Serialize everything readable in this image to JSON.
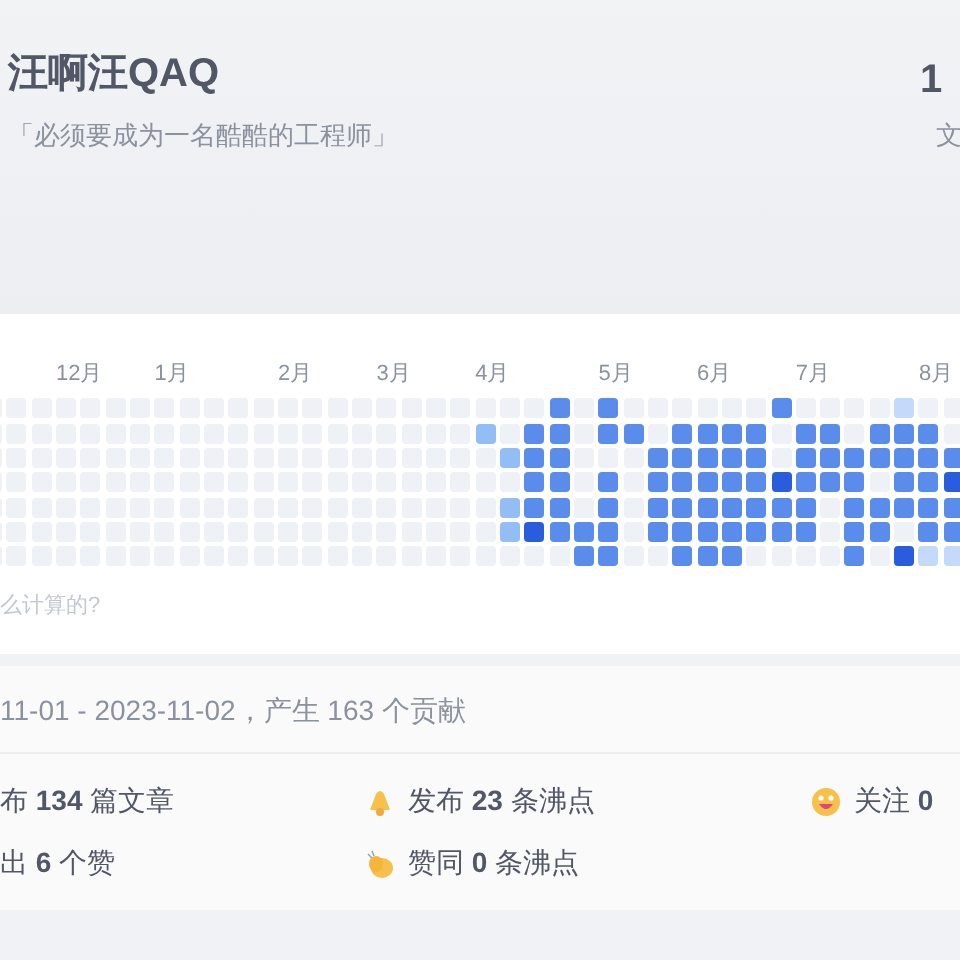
{
  "profile": {
    "name": "汪啊汪QAQ",
    "motto": "「必须要成为一名酷酷的工程师」",
    "stat_value": "1",
    "stat_label": "文"
  },
  "heatmap": {
    "weeks": [
      {
        "days": [
          {
            "color": "#eef1f6"
          },
          {
            "color": "#eef1f6"
          },
          {
            "color": "#eef1f6"
          },
          {
            "color": "#eef1f6"
          },
          {
            "color": "#eef1f6"
          },
          {
            "color": "#eef1f6"
          },
          {
            "color": "#eef1f6"
          }
        ]
      },
      {
        "days": [
          {
            "color": "#eef1f6"
          },
          {
            "color": "#eef1f6"
          },
          {
            "color": "#eef1f6"
          },
          {
            "color": "#eef1f6"
          },
          {
            "color": "#eef1f6"
          },
          {
            "color": "#eef1f6"
          },
          {
            "color": "#eef1f6"
          }
        ]
      },
      {
        "days": [
          {
            "color": "#eef1f6"
          },
          {
            "color": "#eef1f6"
          },
          {
            "color": "#eef1f6"
          },
          {
            "color": "#eef1f6"
          },
          {
            "color": "#eef1f6"
          },
          {
            "color": "#eef1f6"
          },
          {
            "color": "#eef1f6"
          }
        ]
      },
      {
        "month": "12月",
        "days": [
          {
            "color": "#eef1f6"
          },
          {
            "color": "#eef1f6"
          },
          {
            "color": "#eef1f6"
          },
          {
            "color": "#eef1f6"
          },
          {
            "color": "#eef1f6"
          },
          {
            "color": "#eef1f6"
          },
          {
            "color": "#eef1f6"
          }
        ]
      },
      {
        "days": [
          {
            "color": "#eef1f6"
          },
          {
            "color": "#eef1f6"
          },
          {
            "color": "#eef1f6"
          },
          {
            "color": "#eef1f6"
          },
          {
            "color": "#eef1f6"
          },
          {
            "color": "#eef1f6"
          },
          {
            "color": "#eef1f6"
          }
        ]
      },
      {
        "days": [
          {
            "color": "#eef1f6"
          },
          {
            "color": "#eef1f6"
          },
          {
            "color": "#eef1f6"
          },
          {
            "color": "#eef1f6"
          },
          {
            "color": "#eef1f6"
          },
          {
            "color": "#eef1f6"
          },
          {
            "color": "#eef1f6"
          }
        ]
      },
      {
        "days": [
          {
            "color": "#eef1f6"
          },
          {
            "color": "#eef1f6"
          },
          {
            "color": "#eef1f6"
          },
          {
            "color": "#eef1f6"
          },
          {
            "color": "#eef1f6"
          },
          {
            "color": "#eef1f6"
          },
          {
            "color": "#eef1f6"
          }
        ]
      },
      {
        "month": "1月",
        "days": [
          {
            "color": "#eef1f6"
          },
          {
            "color": "#eef1f6"
          },
          {
            "color": "#eef1f6"
          },
          {
            "color": "#eef1f6"
          },
          {
            "color": "#eef1f6"
          },
          {
            "color": "#eef1f6"
          },
          {
            "color": "#eef1f6"
          }
        ]
      },
      {
        "days": [
          {
            "color": "#eef1f6"
          },
          {
            "color": "#eef1f6"
          },
          {
            "color": "#eef1f6"
          },
          {
            "color": "#eef1f6"
          },
          {
            "color": "#eef1f6"
          },
          {
            "color": "#eef1f6"
          },
          {
            "color": "#eef1f6"
          }
        ]
      },
      {
        "days": [
          {
            "color": "#eef1f6"
          },
          {
            "color": "#eef1f6"
          },
          {
            "color": "#eef1f6"
          },
          {
            "color": "#eef1f6"
          },
          {
            "color": "#eef1f6"
          },
          {
            "color": "#eef1f6"
          },
          {
            "color": "#eef1f6"
          }
        ]
      },
      {
        "days": [
          {
            "color": "#eef1f6"
          },
          {
            "color": "#eef1f6"
          },
          {
            "color": "#eef1f6"
          },
          {
            "color": "#eef1f6"
          },
          {
            "color": "#eef1f6"
          },
          {
            "color": "#eef1f6"
          },
          {
            "color": "#eef1f6"
          }
        ]
      },
      {
        "days": [
          {
            "color": "#eef1f6"
          },
          {
            "color": "#eef1f6"
          },
          {
            "color": "#eef1f6"
          },
          {
            "color": "#eef1f6"
          },
          {
            "color": "#eef1f6"
          },
          {
            "color": "#eef1f6"
          },
          {
            "color": "#eef1f6"
          }
        ]
      },
      {
        "month": "2月",
        "days": [
          {
            "color": "#eef1f6"
          },
          {
            "color": "#eef1f6"
          },
          {
            "color": "#eef1f6"
          },
          {
            "color": "#eef1f6"
          },
          {
            "color": "#eef1f6"
          },
          {
            "color": "#eef1f6"
          },
          {
            "color": "#eef1f6"
          }
        ]
      },
      {
        "days": [
          {
            "color": "#eef1f6"
          },
          {
            "color": "#eef1f6"
          },
          {
            "color": "#eef1f6"
          },
          {
            "color": "#eef1f6"
          },
          {
            "color": "#eef1f6"
          },
          {
            "color": "#eef1f6"
          },
          {
            "color": "#eef1f6"
          }
        ]
      },
      {
        "days": [
          {
            "color": "#eef1f6"
          },
          {
            "color": "#eef1f6"
          },
          {
            "color": "#eef1f6"
          },
          {
            "color": "#eef1f6"
          },
          {
            "color": "#eef1f6"
          },
          {
            "color": "#eef1f6"
          },
          {
            "color": "#eef1f6"
          }
        ]
      },
      {
        "days": [
          {
            "color": "#eef1f6"
          },
          {
            "color": "#eef1f6"
          },
          {
            "color": "#eef1f6"
          },
          {
            "color": "#eef1f6"
          },
          {
            "color": "#eef1f6"
          },
          {
            "color": "#eef1f6"
          },
          {
            "color": "#eef1f6"
          }
        ]
      },
      {
        "month": "3月",
        "days": [
          {
            "color": "#eef1f6"
          },
          {
            "color": "#eef1f6"
          },
          {
            "color": "#eef1f6"
          },
          {
            "color": "#eef1f6"
          },
          {
            "color": "#eef1f6"
          },
          {
            "color": "#eef1f6"
          },
          {
            "color": "#eef1f6"
          }
        ]
      },
      {
        "days": [
          {
            "color": "#eef1f6"
          },
          {
            "color": "#eef1f6"
          },
          {
            "color": "#eef1f6"
          },
          {
            "color": "#eef1f6"
          },
          {
            "color": "#eef1f6"
          },
          {
            "color": "#eef1f6"
          },
          {
            "color": "#eef1f6"
          }
        ]
      },
      {
        "days": [
          {
            "color": "#eef1f6"
          },
          {
            "color": "#eef1f6"
          },
          {
            "color": "#eef1f6"
          },
          {
            "color": "#eef1f6"
          },
          {
            "color": "#eef1f6"
          },
          {
            "color": "#eef1f6"
          },
          {
            "color": "#eef1f6"
          }
        ]
      },
      {
        "days": [
          {
            "color": "#eef1f6"
          },
          {
            "color": "#eef1f6"
          },
          {
            "color": "#eef1f6"
          },
          {
            "color": "#eef1f6"
          },
          {
            "color": "#eef1f6"
          },
          {
            "color": "#eef1f6"
          },
          {
            "color": "#eef1f6"
          }
        ]
      },
      {
        "month": "4月",
        "days": [
          {
            "color": "#eef1f6"
          },
          {
            "color": "#93bdf5"
          },
          {
            "color": "#eef1f6"
          },
          {
            "color": "#eef1f6"
          },
          {
            "color": "#eef1f6"
          },
          {
            "color": "#eef1f6"
          },
          {
            "color": "#eef1f6"
          }
        ]
      },
      {
        "days": [
          {
            "color": "#eef1f6"
          },
          {
            "color": "#eef1f6"
          },
          {
            "color": "#93bdf5"
          },
          {
            "color": "#eef1f6"
          },
          {
            "color": "#93bdf5"
          },
          {
            "color": "#93bdf5"
          },
          {
            "color": "#eef1f6"
          }
        ]
      },
      {
        "days": [
          {
            "color": "#eef1f6"
          },
          {
            "color": "#5a8ceb"
          },
          {
            "color": "#5a8ceb"
          },
          {
            "color": "#5a8ceb"
          },
          {
            "color": "#5a8ceb"
          },
          {
            "color": "#2a5ddb"
          },
          {
            "color": "#eef1f6"
          }
        ]
      },
      {
        "days": [
          {
            "color": "#5a8ceb"
          },
          {
            "color": "#5a8ceb"
          },
          {
            "color": "#5a8ceb"
          },
          {
            "color": "#5a8ceb"
          },
          {
            "color": "#5a8ceb"
          },
          {
            "color": "#5a8ceb"
          },
          {
            "color": "#eef1f6"
          }
        ]
      },
      {
        "days": [
          {
            "color": "#eef1f6"
          },
          {
            "color": "#eef1f6"
          },
          {
            "color": "#eef1f6"
          },
          {
            "color": "#eef1f6"
          },
          {
            "color": "#eef1f6"
          },
          {
            "color": "#5a8ceb"
          },
          {
            "color": "#5a8ceb"
          }
        ]
      },
      {
        "month": "5月",
        "days": [
          {
            "color": "#5a8ceb"
          },
          {
            "color": "#5a8ceb"
          },
          {
            "color": "#eef1f6"
          },
          {
            "color": "#5a8ceb"
          },
          {
            "color": "#5a8ceb"
          },
          {
            "color": "#5a8ceb"
          },
          {
            "color": "#5a8ceb"
          }
        ]
      },
      {
        "days": [
          {
            "color": "#eef1f6"
          },
          {
            "color": "#5a8ceb"
          },
          {
            "color": "#eef1f6"
          },
          {
            "color": "#eef1f6"
          },
          {
            "color": "#eef1f6"
          },
          {
            "color": "#eef1f6"
          },
          {
            "color": "#eef1f6"
          }
        ]
      },
      {
        "days": [
          {
            "color": "#eef1f6"
          },
          {
            "color": "#eef1f6"
          },
          {
            "color": "#5a8ceb"
          },
          {
            "color": "#5a8ceb"
          },
          {
            "color": "#5a8ceb"
          },
          {
            "color": "#5a8ceb"
          },
          {
            "color": "#eef1f6"
          }
        ]
      },
      {
        "days": [
          {
            "color": "#eef1f6"
          },
          {
            "color": "#5a8ceb"
          },
          {
            "color": "#5a8ceb"
          },
          {
            "color": "#5a8ceb"
          },
          {
            "color": "#5a8ceb"
          },
          {
            "color": "#5a8ceb"
          },
          {
            "color": "#5a8ceb"
          }
        ]
      },
      {
        "month": "6月",
        "days": [
          {
            "color": "#eef1f6"
          },
          {
            "color": "#5a8ceb"
          },
          {
            "color": "#5a8ceb"
          },
          {
            "color": "#5a8ceb"
          },
          {
            "color": "#5a8ceb"
          },
          {
            "color": "#5a8ceb"
          },
          {
            "color": "#5a8ceb"
          }
        ]
      },
      {
        "days": [
          {
            "color": "#eef1f6"
          },
          {
            "color": "#5a8ceb"
          },
          {
            "color": "#5a8ceb"
          },
          {
            "color": "#5a8ceb"
          },
          {
            "color": "#5a8ceb"
          },
          {
            "color": "#5a8ceb"
          },
          {
            "color": "#5a8ceb"
          }
        ]
      },
      {
        "days": [
          {
            "color": "#eef1f6"
          },
          {
            "color": "#5a8ceb"
          },
          {
            "color": "#5a8ceb"
          },
          {
            "color": "#5a8ceb"
          },
          {
            "color": "#5a8ceb"
          },
          {
            "color": "#5a8ceb"
          },
          {
            "color": "#eef1f6"
          }
        ]
      },
      {
        "days": [
          {
            "color": "#5a8ceb"
          },
          {
            "color": "#eef1f6"
          },
          {
            "color": "#eef1f6"
          },
          {
            "color": "#2a5ddb"
          },
          {
            "color": "#5a8ceb"
          },
          {
            "color": "#5a8ceb"
          },
          {
            "color": "#eef1f6"
          }
        ]
      },
      {
        "month": "7月",
        "days": [
          {
            "color": "#eef1f6"
          },
          {
            "color": "#5a8ceb"
          },
          {
            "color": "#5a8ceb"
          },
          {
            "color": "#5a8ceb"
          },
          {
            "color": "#5a8ceb"
          },
          {
            "color": "#5a8ceb"
          },
          {
            "color": "#eef1f6"
          }
        ]
      },
      {
        "days": [
          {
            "color": "#eef1f6"
          },
          {
            "color": "#5a8ceb"
          },
          {
            "color": "#5a8ceb"
          },
          {
            "color": "#5a8ceb"
          },
          {
            "color": "#eef1f6"
          },
          {
            "color": "#eef1f6"
          },
          {
            "color": "#eef1f6"
          }
        ]
      },
      {
        "days": [
          {
            "color": "#eef1f6"
          },
          {
            "color": "#eef1f6"
          },
          {
            "color": "#5a8ceb"
          },
          {
            "color": "#5a8ceb"
          },
          {
            "color": "#5a8ceb"
          },
          {
            "color": "#5a8ceb"
          },
          {
            "color": "#5a8ceb"
          }
        ]
      },
      {
        "days": [
          {
            "color": "#eef1f6"
          },
          {
            "color": "#5a8ceb"
          },
          {
            "color": "#5a8ceb"
          },
          {
            "color": "#eef1f6"
          },
          {
            "color": "#5a8ceb"
          },
          {
            "color": "#5a8ceb"
          },
          {
            "color": "#eef1f6"
          }
        ]
      },
      {
        "days": [
          {
            "color": "#c4dafb"
          },
          {
            "color": "#5a8ceb"
          },
          {
            "color": "#5a8ceb"
          },
          {
            "color": "#5a8ceb"
          },
          {
            "color": "#5a8ceb"
          },
          {
            "color": "#eef1f6"
          },
          {
            "color": "#2a5ddb"
          }
        ]
      },
      {
        "month": "8月",
        "days": [
          {
            "color": "#eef1f6"
          },
          {
            "color": "#5a8ceb"
          },
          {
            "color": "#5a8ceb"
          },
          {
            "color": "#5a8ceb"
          },
          {
            "color": "#5a8ceb"
          },
          {
            "color": "#5a8ceb"
          },
          {
            "color": "#c4dafb"
          }
        ]
      },
      {
        "days": [
          {
            "color": "#eef1f6"
          },
          {
            "color": "#eef1f6"
          },
          {
            "color": "#5a8ceb"
          },
          {
            "color": "#2a5ddb"
          },
          {
            "color": "#5a8ceb"
          },
          {
            "color": "#5a8ceb"
          },
          {
            "color": "#c4dafb"
          }
        ]
      }
    ],
    "help_link": "么计算的?"
  },
  "summary": "11-01 - 2023-11-02，产生 163 个贡献",
  "stats": [
    {
      "kind": "none",
      "text": "布 **134** 篇文章"
    },
    {
      "kind": "bell",
      "text": "发布 **23** 条沸点"
    },
    {
      "kind": "smile",
      "text": "关注 **0**"
    },
    {
      "kind": "none",
      "text": "出 **6** 个赞"
    },
    {
      "kind": "clap",
      "text": "赞同 **0** 条沸点"
    }
  ]
}
